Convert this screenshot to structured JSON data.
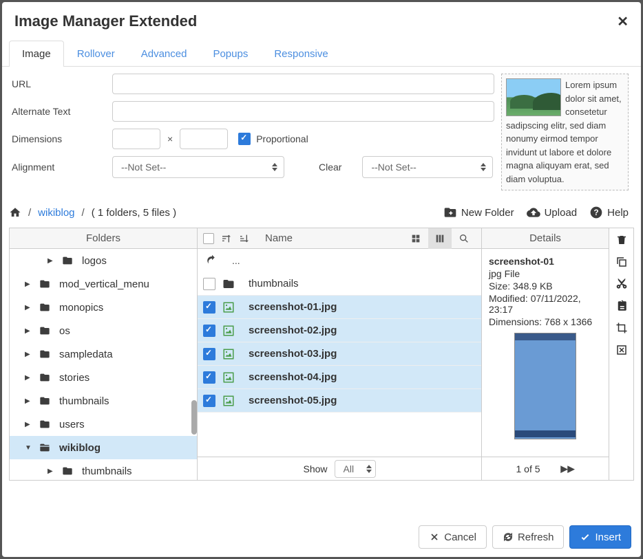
{
  "title": "Image Manager Extended",
  "tabs": [
    "Image",
    "Rollover",
    "Advanced",
    "Popups",
    "Responsive"
  ],
  "form": {
    "url_label": "URL",
    "alt_label": "Alternate Text",
    "dim_label": "Dimensions",
    "proportional_label": "Proportional",
    "align_label": "Alignment",
    "align_value": "--Not Set--",
    "clear_label": "Clear",
    "clear_value": "--Not Set--"
  },
  "preview_text": "Lorem ipsum dolor sit amet, consetetur sadipscing elitr, sed diam nonumy eirmod tempor invidunt ut labore et dolore magna aliquyam erat, sed diam voluptua.",
  "breadcrumb": {
    "link": "wikiblog",
    "tail": "( 1 folders, 5 files )"
  },
  "toolbar": {
    "new_folder": "New Folder",
    "upload": "Upload",
    "help": "Help"
  },
  "tree": {
    "header": "Folders",
    "items": [
      {
        "label": "logos",
        "indent": true
      },
      {
        "label": "mod_vertical_menu"
      },
      {
        "label": "monopics"
      },
      {
        "label": "os"
      },
      {
        "label": "sampledata"
      },
      {
        "label": "stories"
      },
      {
        "label": "thumbnails"
      },
      {
        "label": "users"
      },
      {
        "label": "wikiblog",
        "active": true,
        "open": true
      },
      {
        "label": "thumbnails",
        "indent": true
      }
    ]
  },
  "list": {
    "name_col": "Name",
    "up": "...",
    "rows": [
      {
        "name": "thumbnails",
        "folder": true,
        "sel": false
      },
      {
        "name": "screenshot-01.jpg",
        "sel": true
      },
      {
        "name": "screenshot-02.jpg",
        "sel": true
      },
      {
        "name": "screenshot-03.jpg",
        "sel": true
      },
      {
        "name": "screenshot-04.jpg",
        "sel": true
      },
      {
        "name": "screenshot-05.jpg",
        "sel": true
      }
    ],
    "show_label": "Show",
    "show_value": "All"
  },
  "details": {
    "header": "Details",
    "filename": "screenshot-01",
    "type": "jpg File",
    "size": "Size: 348.9 KB",
    "modified": "Modified: 07/11/2022, 23:17",
    "dimensions": "Dimensions: 768 x 1366",
    "pager": "1 of 5"
  },
  "footer": {
    "cancel": "Cancel",
    "refresh": "Refresh",
    "insert": "Insert"
  }
}
